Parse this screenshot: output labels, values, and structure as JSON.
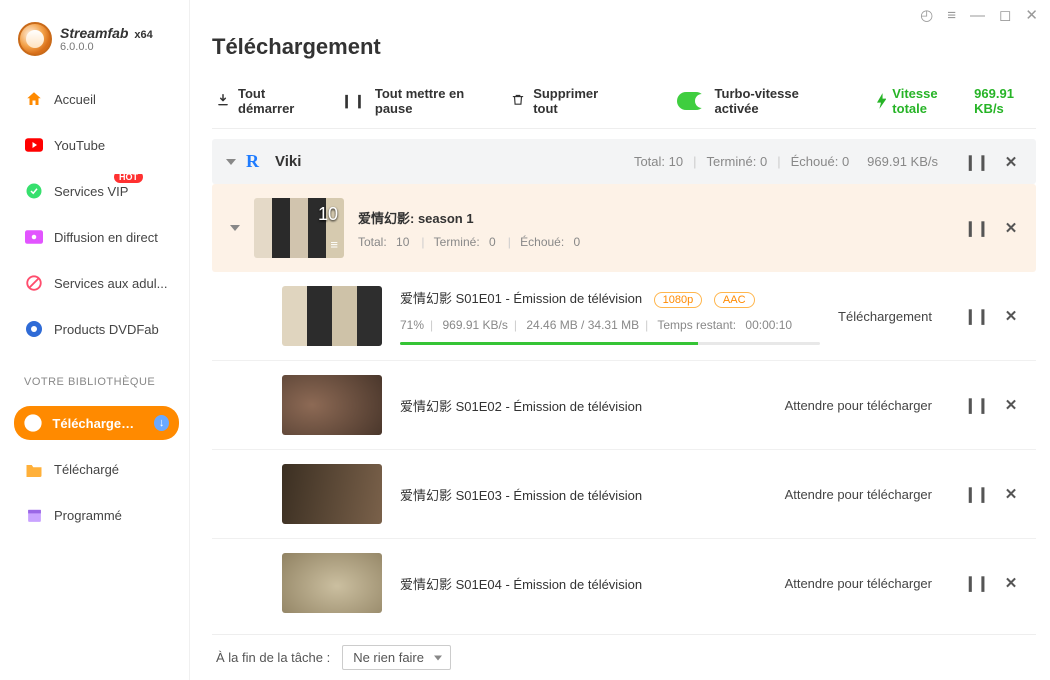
{
  "brand": {
    "name": "Streamfab",
    "arch": "x64",
    "version": "6.0.0.0"
  },
  "sidebar": {
    "items": [
      {
        "label": "Accueil"
      },
      {
        "label": "YouTube"
      },
      {
        "label": "Services VIP",
        "badge": "HOT"
      },
      {
        "label": "Diffusion en direct"
      },
      {
        "label": "Services aux adul..."
      },
      {
        "label": "Products DVDFab"
      }
    ],
    "section_label": "VOTRE BIBLIOTHÈQUE",
    "lib": [
      {
        "label": "Téléchargement",
        "active": true
      },
      {
        "label": "Téléchargé"
      },
      {
        "label": "Programmé"
      }
    ]
  },
  "page": {
    "title": "Téléchargement"
  },
  "toolbar": {
    "start_all": "Tout démarrer",
    "pause_all": "Tout mettre en pause",
    "delete_all": "Supprimer tout",
    "turbo_label": "Turbo-vitesse activée",
    "total_speed_label": "Vitesse totale",
    "total_speed_value": "969.91 KB/s"
  },
  "source": {
    "name": "Viki",
    "total_label": "Total:",
    "total": "10",
    "done_label": "Terminé:",
    "done": "0",
    "fail_label": "Échoué:",
    "fail": "0",
    "speed": "969.91 KB/s"
  },
  "season": {
    "title": "爱情幻影: season 1",
    "thumb_count": "10",
    "total_label": "Total:",
    "total": "10",
    "done_label": "Terminé:",
    "done": "0",
    "fail_label": "Échoué:",
    "fail": "0"
  },
  "episodes": [
    {
      "title": "爱情幻影 S01E01 - Émission de télévision",
      "tags": [
        "1080p",
        "AAC"
      ],
      "percent": "71%",
      "speed": "969.91 KB/s",
      "size": "24.46 MB / 34.31 MB",
      "eta_label": "Temps restant:",
      "eta": "00:00:10",
      "status": "Téléchargement",
      "progress": 71
    },
    {
      "title": "爱情幻影 S01E02 - Émission de télévision",
      "status": "Attendre pour télécharger"
    },
    {
      "title": "爱情幻影 S01E03 - Émission de télévision",
      "status": "Attendre pour télécharger"
    },
    {
      "title": "爱情幻影 S01E04 - Émission de télévision",
      "status": "Attendre pour télécharger"
    }
  ],
  "footer": {
    "label": "À la fin de la tâche :",
    "option": "Ne rien faire"
  }
}
